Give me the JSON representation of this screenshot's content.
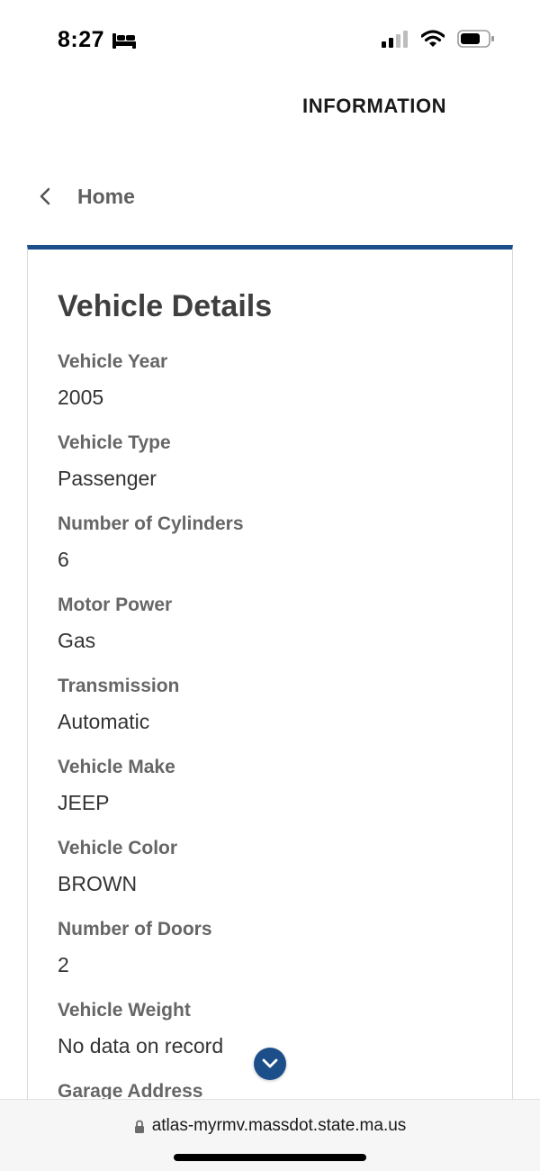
{
  "status_bar": {
    "time": "8:27",
    "icons": [
      "bed-icon",
      "signal-icon",
      "wifi-icon",
      "battery-icon"
    ]
  },
  "header": {
    "title": "INFORMATION"
  },
  "nav": {
    "back_label": "Home",
    "back_icon": "chevron-left-icon"
  },
  "card": {
    "title": "Vehicle Details",
    "accent_color": "#1c4f8a",
    "fields": [
      {
        "label": "Vehicle Year",
        "value": "2005"
      },
      {
        "label": "Vehicle Type",
        "value": "Passenger"
      },
      {
        "label": "Number of Cylinders",
        "value": "6"
      },
      {
        "label": "Motor Power",
        "value": "Gas"
      },
      {
        "label": "Transmission",
        "value": "Automatic"
      },
      {
        "label": "Vehicle Make",
        "value": "JEEP"
      },
      {
        "label": "Vehicle Color",
        "value": "BROWN"
      },
      {
        "label": "Number of Doors",
        "value": "2"
      },
      {
        "label": "Vehicle Weight",
        "value": "No data on record"
      },
      {
        "label": "Garage Address",
        "value": ""
      }
    ]
  },
  "scroll_button": {
    "icon": "chevron-down-icon"
  },
  "browser": {
    "url": "atlas-myrmv.massdot.state.ma.us",
    "lock_icon": "lock-icon"
  }
}
